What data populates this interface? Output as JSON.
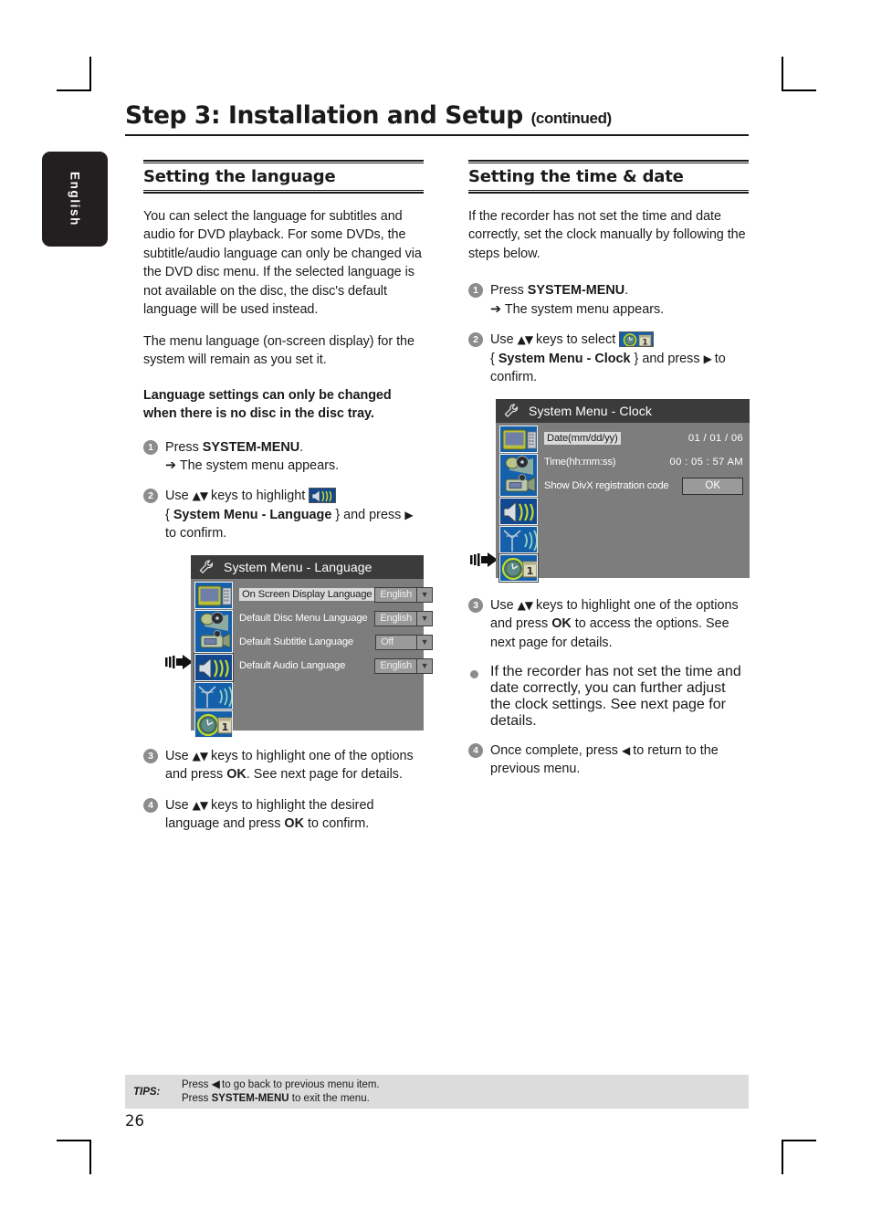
{
  "page": {
    "running_head": "Step 3: Installation and Setup",
    "running_head_suffix": "(continued)",
    "side_tab": "English",
    "page_number": "26"
  },
  "left_column": {
    "heading": "Setting the language",
    "paragraphs": [
      "You can select the language for subtitles and audio for DVD playback. For some DVDs, the subtitle/audio language can only be changed via the DVD disc menu. If the selected language is not available on the disc, the disc's default language will be used instead.",
      "The menu language (on-screen display) for the system will remain as you set it."
    ],
    "note": "Language settings can only be changed when there is no disc in the disc tray.",
    "steps": [
      {
        "num": "1",
        "text_before": "Press ",
        "bold": "SYSTEM-MENU",
        "text_after": ".",
        "sub": "The system menu appears."
      },
      {
        "num": "2",
        "line1_a": "Use ",
        "line1_keys": "▲▼",
        "line1_b": " keys to highlight ",
        "icon": "speaker-audio-icon",
        "line2_a": "{ ",
        "line2_bold": "System Menu - Language",
        "line2_b": " } and press ",
        "line2_key": "▶",
        "line2_c": " to confirm."
      },
      {
        "num": "3",
        "a": "Use ",
        "keys": "▲▼",
        "b": " keys to highlight one of the options and press ",
        "bold": "OK",
        "c": ". See next page for details."
      },
      {
        "num": "4",
        "a": "Use ",
        "keys": "▲▼",
        "b": " keys to highlight the desired language and press ",
        "bold": "OK",
        "c": " to confirm."
      }
    ],
    "osd": {
      "title": "System Menu - Language",
      "icons": [
        "tv-display-icon",
        "playback-record-icon",
        "speaker-audio-icon",
        "antenna-reception-icon",
        "clock-calendar-icon"
      ],
      "selected_icon_index": 2,
      "rows": [
        {
          "label": "On Screen Display Language",
          "value": "English",
          "highlighted": true,
          "control": "dropdown"
        },
        {
          "label": "Default Disc Menu Language",
          "value": "English",
          "highlighted": false,
          "control": "dropdown"
        },
        {
          "label": "Default Subtitle Language",
          "value": "Off",
          "highlighted": false,
          "control": "dropdown"
        },
        {
          "label": "Default Audio Language",
          "value": "English",
          "highlighted": false,
          "control": "dropdown"
        }
      ]
    }
  },
  "right_column": {
    "heading": "Setting the time & date",
    "paragraphs": [
      "If the recorder has not set the time and date correctly, set the clock manually by following the steps below."
    ],
    "steps": [
      {
        "num": "1",
        "text_before": "Press ",
        "bold": "SYSTEM-MENU",
        "text_after": ".",
        "sub": "The system menu appears."
      },
      {
        "num": "2",
        "line1_a": "Use ",
        "line1_keys": "▲▼",
        "line1_b": " keys to select ",
        "icon": "clock-calendar-icon",
        "line2_a": "{ ",
        "line2_bold": "System Menu - Clock",
        "line2_b": " } and press ",
        "line2_key": "▶",
        "line2_c": " to confirm."
      },
      {
        "num": "3",
        "a": "Use ",
        "keys": "▲▼",
        "b": " keys to highlight one of the options and press ",
        "bold": "OK",
        "c": " to access the options. See next page for details."
      }
    ],
    "bullet": "If the recorder has not set the time and date correctly, you can further adjust the clock settings. See next page for details.",
    "step4": {
      "num": "4",
      "a": "Once complete, press ",
      "key": "◀",
      "b": " to return to the previous menu."
    },
    "osd": {
      "title": "System Menu - Clock",
      "icons": [
        "tv-display-icon",
        "playback-record-icon",
        "speaker-audio-icon",
        "antenna-reception-icon",
        "clock-calendar-icon"
      ],
      "selected_icon_index": 4,
      "rows": [
        {
          "label": "Date(mm/dd/yy)",
          "value": "01 / 01 / 06",
          "highlighted": true,
          "control": "text"
        },
        {
          "label": "Time(hh:mm:ss)",
          "value": "00 : 05 : 57 AM",
          "highlighted": false,
          "control": "text"
        },
        {
          "label": "Show DivX registration code",
          "value": "OK",
          "highlighted": false,
          "control": "button"
        }
      ]
    }
  },
  "tips": {
    "label": "TIPS:",
    "line1_a": "Press ",
    "line1_key": "◀",
    "line1_b": " to go back to previous menu item.",
    "line2_a": "Press ",
    "line2_bold": "SYSTEM-MENU",
    "line2_b": " to exit the menu."
  },
  "colors": {
    "osd_background": "#7d7d7d",
    "osd_titlebar": "#3b3b3b",
    "osd_icon_blue": "#1560ab",
    "tips_strip": "#dcdcdc",
    "step_badge": "#8c8c8c",
    "side_tab": "#231f20"
  }
}
